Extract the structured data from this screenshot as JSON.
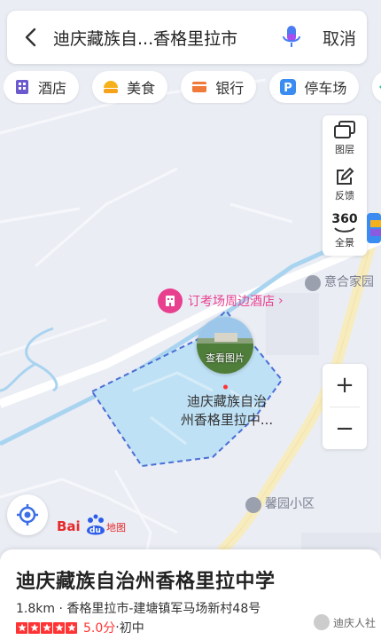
{
  "search": {
    "query": "迪庆藏族自...香格里拉市",
    "cancel": "取消"
  },
  "categories": [
    {
      "label": "酒店",
      "icon": "hotel-icon",
      "color": "#6a5acd"
    },
    {
      "label": "美食",
      "icon": "food-icon",
      "color": "#f6b11a"
    },
    {
      "label": "银行",
      "icon": "bank-icon",
      "color": "#f07a3a"
    },
    {
      "label": "停车场",
      "icon": "parking-icon",
      "color": "#3b8cf0"
    }
  ],
  "tools": {
    "layers": "图层",
    "feedback": "反馈",
    "pano_badge": "360",
    "pano": "全景"
  },
  "zoom": {
    "in": "+",
    "out": "−"
  },
  "map": {
    "poi_photo": "查看图片",
    "poi_name_line1": "迪庆藏族自治",
    "poi_name_line2": "州香格里拉中...",
    "hotel_promo": "订考场周边酒店",
    "nearby_1": "意合家园",
    "nearby_2": "馨园小区",
    "area_color": "#bfe1f5",
    "boundary_color": "#4a6fd6",
    "river_color": "#a9d4ef",
    "road_color": "#f7efc8"
  },
  "logo": {
    "prefix": "Bai",
    "mid": "du",
    "suffix": "地图"
  },
  "card": {
    "title": "迪庆藏族自治州香格里拉中学",
    "address": "1.8km · 香格里拉市-建塘镇军马场新村48号",
    "rating_stars": 5,
    "score": "5.0分",
    "separator": "·",
    "grade": "初中",
    "accent": "#f33333"
  },
  "watermark": "迪庆人社"
}
